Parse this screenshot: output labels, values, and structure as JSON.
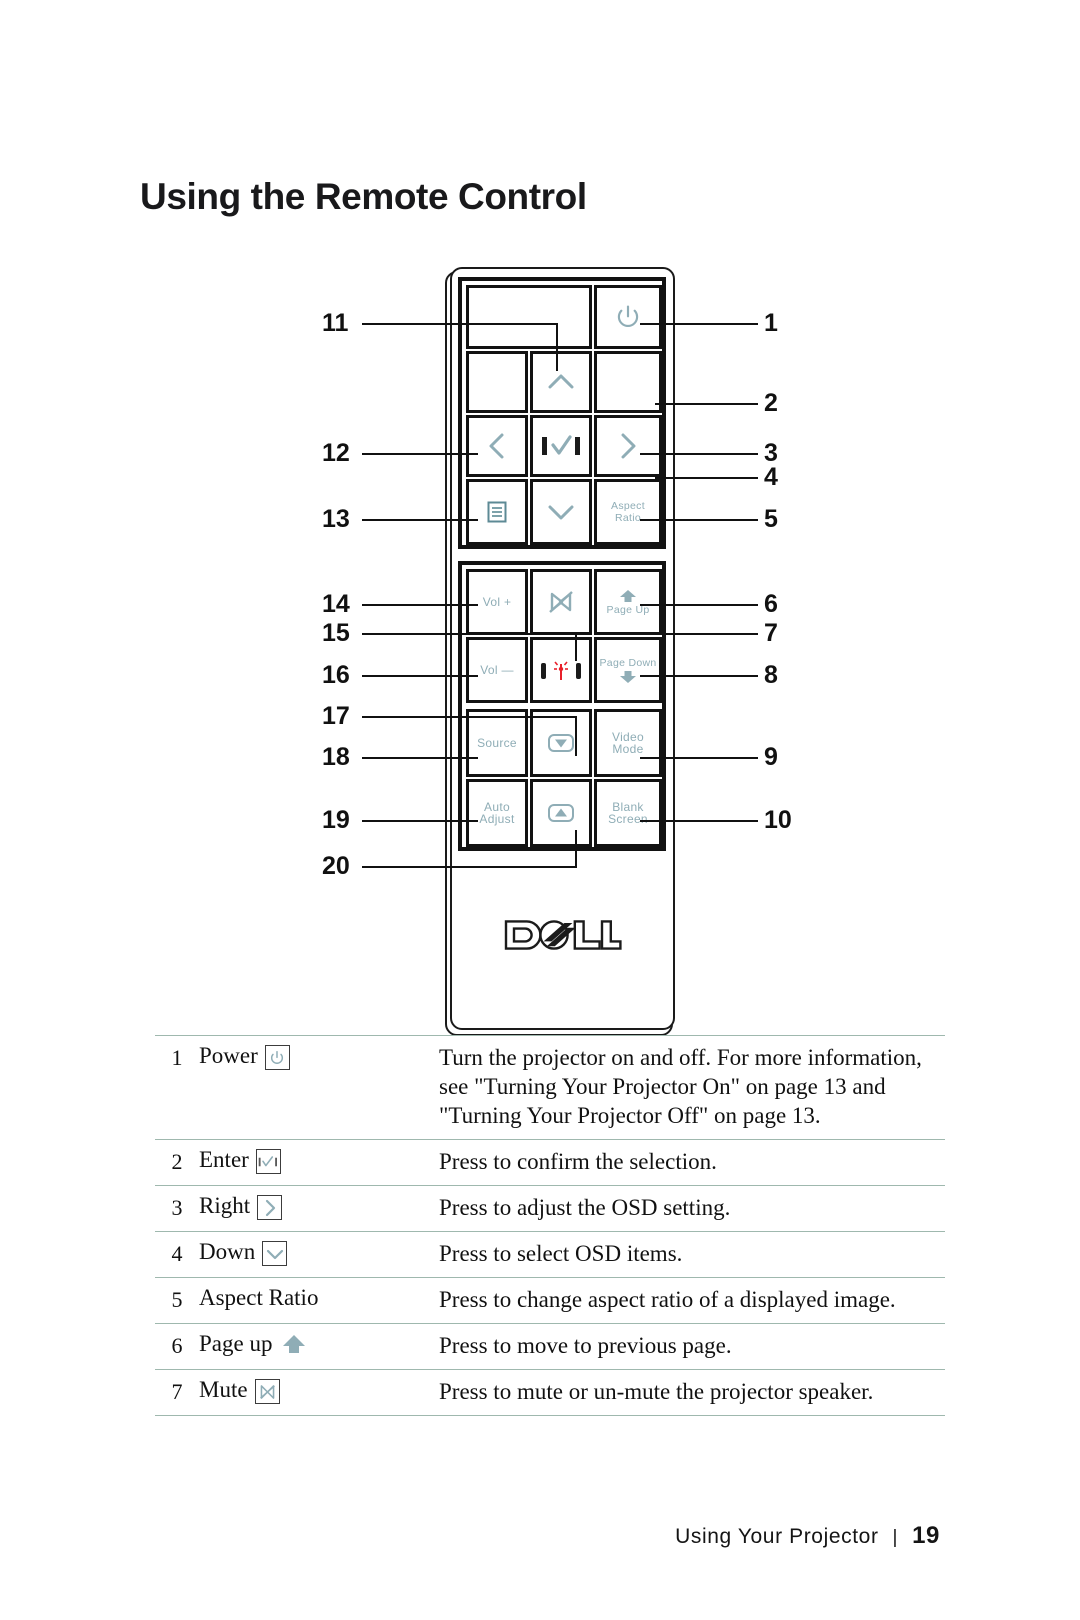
{
  "page": {
    "title": "Using the Remote Control",
    "footer_section": "Using Your Projector",
    "footer_separator": "|",
    "footer_page": "19"
  },
  "figure": {
    "brand": "DELL",
    "keys": {
      "power": "power-icon",
      "up": "up-arrow",
      "left": "left-arrow",
      "enter": "enter-check",
      "right": "right-arrow",
      "menu": "menu-icon",
      "down": "down-arrow",
      "aspect_ratio": "Aspect\nRatio",
      "aspect_ratio_line1": "Aspect",
      "aspect_ratio_line2": "Ratio",
      "vol_up": "Vol +",
      "mute": "mute-icon",
      "page_up": "Page Up",
      "vol_down": "Vol —",
      "laser": "laser-icon",
      "page_down": "Page Down",
      "source": "Source",
      "keystone_up": "keystone-up-icon",
      "video_mode_line1": "Video",
      "video_mode_line2": "Mode",
      "auto_adjust_line1": "Auto",
      "auto_adjust_line2": "Adjust",
      "keystone_down": "keystone-down-icon",
      "blank_screen_line1": "Blank",
      "blank_screen_line2": "Screen"
    },
    "callouts_right": [
      "1",
      "2",
      "3",
      "4",
      "5",
      "6",
      "7",
      "8",
      "9",
      "10"
    ],
    "callouts_left": [
      "11",
      "12",
      "13",
      "14",
      "15",
      "16",
      "17",
      "18",
      "19",
      "20"
    ]
  },
  "table": {
    "rows": [
      {
        "num": "1",
        "name": "Power",
        "icon": "power-icon",
        "desc": "Turn the projector on and off. For more information, see \"Turning Your Projector On\" on page 13 and \"Turning Your Projector Off\" on page 13."
      },
      {
        "num": "2",
        "name": "Enter",
        "icon": "enter-check-icon",
        "desc": "Press to confirm the selection."
      },
      {
        "num": "3",
        "name": "Right",
        "icon": "right-arrow-icon",
        "desc": "Press to adjust the OSD setting."
      },
      {
        "num": "4",
        "name": "Down",
        "icon": "down-arrow-icon",
        "desc": "Press to select OSD items."
      },
      {
        "num": "5",
        "name": "Aspect Ratio",
        "icon": "",
        "desc": "Press to change aspect ratio of a displayed image."
      },
      {
        "num": "6",
        "name": "Page up",
        "icon": "page-up-arrow-icon",
        "desc": "Press to move to previous page."
      },
      {
        "num": "7",
        "name": "Mute",
        "icon": "mute-icon",
        "desc": "Press to mute or un-mute the projector speaker."
      }
    ]
  },
  "colors": {
    "accent": "#8fadb6",
    "rule": "#9fb8ae",
    "ink": "#111111",
    "laser_red": "#e8202a"
  }
}
